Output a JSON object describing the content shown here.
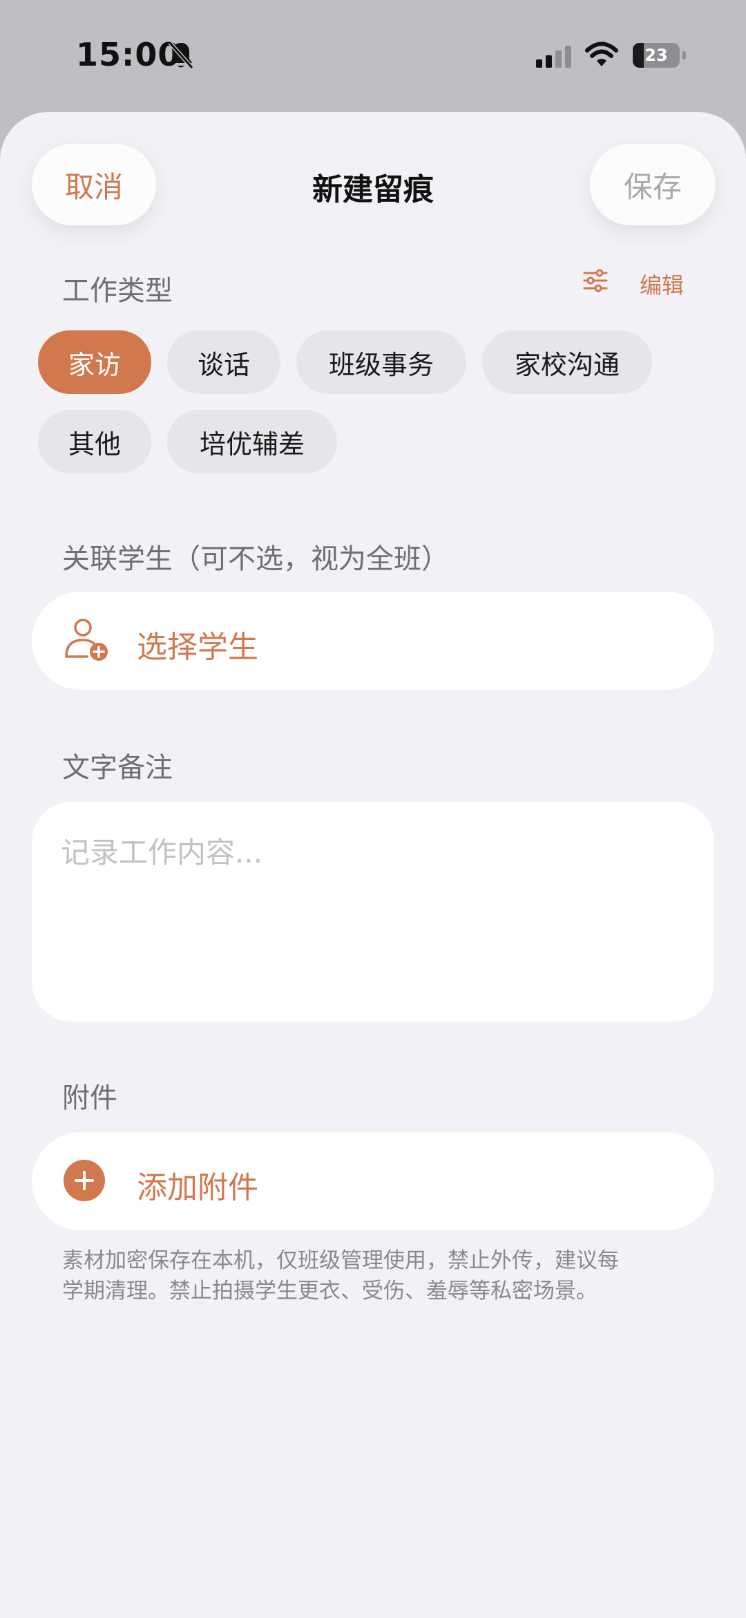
{
  "status_bar": {
    "time": "15:00",
    "battery_level": "23",
    "icons": [
      "bell-slash-icon",
      "signal-icon",
      "wifi-icon",
      "battery-icon"
    ]
  },
  "header": {
    "cancel_label": "取消",
    "title": "新建留痕",
    "save_label": "保存"
  },
  "work_type": {
    "label": "工作类型",
    "edit_label": "编辑",
    "chips": [
      {
        "label": "家访",
        "selected": true
      },
      {
        "label": "谈话",
        "selected": false
      },
      {
        "label": "班级事务",
        "selected": false
      },
      {
        "label": "家校沟通",
        "selected": false
      },
      {
        "label": "其他",
        "selected": false
      },
      {
        "label": "培优辅差",
        "selected": false
      }
    ]
  },
  "students": {
    "label": "关联学生（可不选，视为全班）",
    "select_label": "选择学生"
  },
  "note": {
    "label": "文字备注",
    "placeholder": "记录工作内容...",
    "value": ""
  },
  "attachments": {
    "label": "附件",
    "add_label": "添加附件",
    "disclaimer": "素材加密保存在本机，仅班级管理使用，禁止外传，建议每学期清理。禁止拍摄学生更衣、受伤、羞辱等私密场景。"
  },
  "colors": {
    "accent": "#d2784f",
    "background": "#f2f2f6",
    "chip_inactive": "#e5e5ea",
    "muted_text": "#6e6e73"
  }
}
